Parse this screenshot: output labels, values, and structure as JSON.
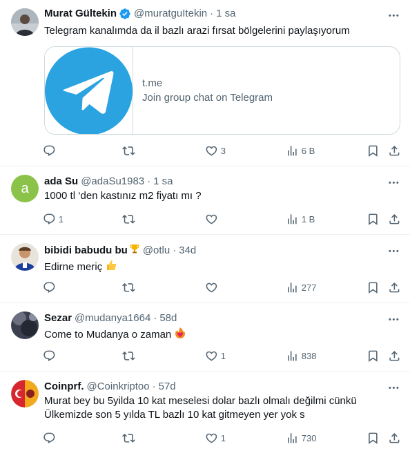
{
  "tweets": [
    {
      "name": "Murat Gültekin",
      "handle": "@muratguItekin",
      "time": "1 sa",
      "text": "Telegram kanalımda da il bazlı arazi fırsat bölgelerini paylaşıyorum",
      "verified": true,
      "card": {
        "domain": "t.me",
        "title": "Join group chat on Telegram",
        "icon": "telegram-logo"
      },
      "reply_count": "",
      "retweet_count": "",
      "like_count": "3",
      "view_count": "6 B"
    },
    {
      "name": "ada Su",
      "handle": "@adaSu1983",
      "time": "1 sa",
      "text": "1000 tl ‘den kastınız m2 fiyatı mı ?",
      "avatar_letter": "a",
      "reply_count": "1",
      "retweet_count": "",
      "like_count": "",
      "view_count": "1 B"
    },
    {
      "name": "bibidi babudu bu",
      "handle": "@otlu",
      "time": "34d",
      "text": "Edirne meriç",
      "name_emoji": "trophy",
      "text_emoji": "thumbs-up",
      "reply_count": "",
      "retweet_count": "",
      "like_count": "",
      "view_count": "277"
    },
    {
      "name": "Sezar",
      "handle": "@mudanya1664",
      "time": "58d",
      "text": "Come to Mudanya o zaman",
      "text_emoji": "heart-on-fire",
      "reply_count": "",
      "retweet_count": "",
      "like_count": "1",
      "view_count": "838"
    },
    {
      "name": "Coinprf.",
      "handle": "@Coinkriptoo",
      "time": "57d",
      "text_line1": "Murat bey bu 5yilda 10 kat meselesi dolar bazlı olmalı değilmi cünkü",
      "text_line2": "Ülkemizde son 5 yılda TL bazlı 10 kat gitmeyen  yer yok s",
      "reply_count": "",
      "retweet_count": "",
      "like_count": "1",
      "view_count": "730"
    }
  ],
  "separator": "·",
  "colors": {
    "text": "#0f1419",
    "secondary": "#536471",
    "verified": "#1d9bf0",
    "telegram": "#2aa3e0",
    "avatar_ada": "#8bc34a",
    "border": "#eff3f4"
  },
  "icons": [
    "reply-icon",
    "retweet-icon",
    "like-icon",
    "views-icon",
    "bookmark-icon",
    "share-icon",
    "more-icon",
    "verified-badge-icon"
  ]
}
